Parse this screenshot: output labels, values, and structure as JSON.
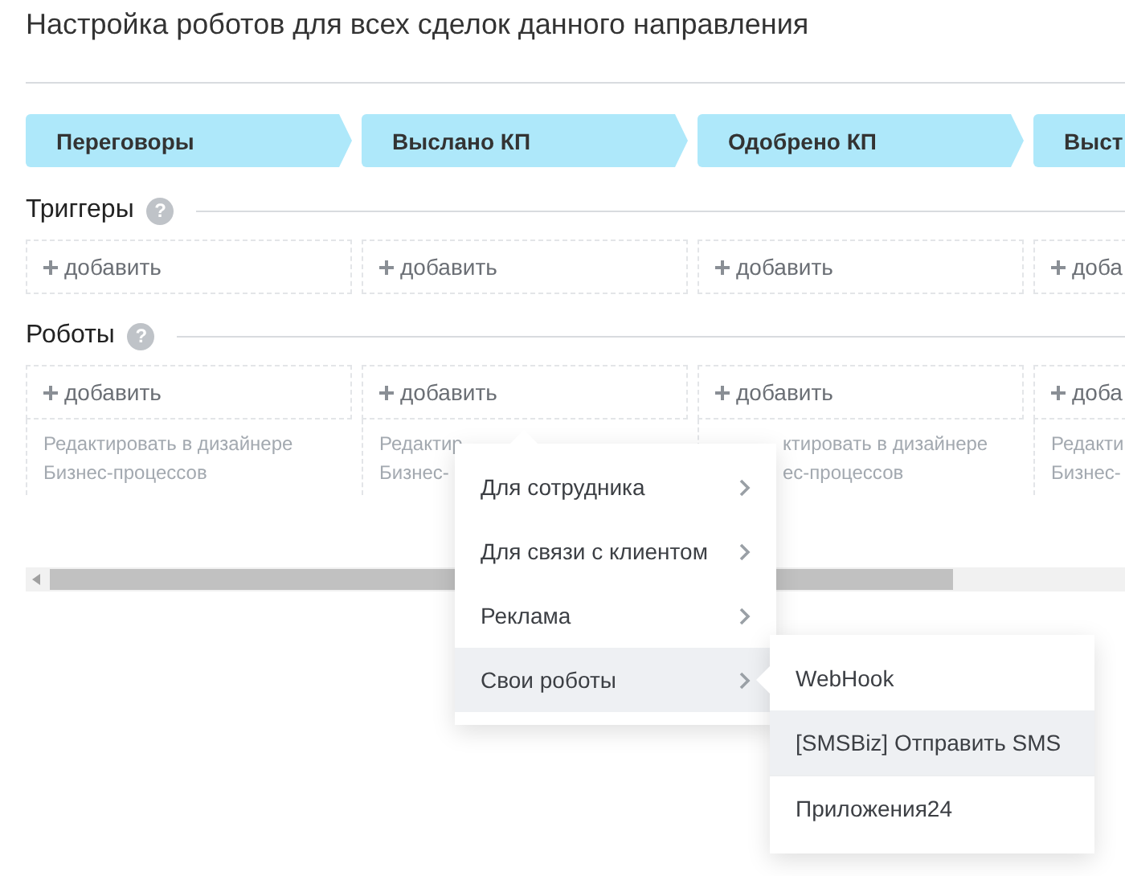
{
  "title": "Настройка роботов для всех сделок данного направления",
  "stages": [
    {
      "label": "Переговоры"
    },
    {
      "label": "Выслано КП"
    },
    {
      "label": "Одобрено КП"
    },
    {
      "label": "Выст"
    }
  ],
  "triggers": {
    "heading": "Триггеры",
    "help": "?",
    "cells": [
      {
        "add": "добавить"
      },
      {
        "add": "добавить"
      },
      {
        "add": "добавить"
      },
      {
        "add": "доба"
      }
    ]
  },
  "robots": {
    "heading": "Роботы",
    "help": "?",
    "cells": [
      {
        "add": "добавить",
        "kind": "plain",
        "edit_lines": [
          "Редактировать в дизайнере",
          "Бизнес-процессов"
        ]
      },
      {
        "add": "добавить",
        "kind": "plain",
        "edit_lines": [
          "Редактир",
          "Бизнес-"
        ]
      },
      {
        "add": "добавить",
        "kind": "cut_left",
        "edit_lines": [
          "ктировать в дизайнере",
          "ес-процессов"
        ]
      },
      {
        "add": "доба",
        "kind": "plain",
        "edit_lines": [
          "Редакти",
          "Бизнес-"
        ]
      }
    ]
  },
  "menu": {
    "items": [
      {
        "label": "Для сотрудника",
        "selected": false
      },
      {
        "label": "Для связи с клиентом",
        "selected": false
      },
      {
        "label": "Реклама",
        "selected": false
      },
      {
        "label": "Свои роботы",
        "selected": true
      }
    ]
  },
  "submenu": {
    "items": [
      {
        "label": "WebHook",
        "selected": false
      },
      {
        "label": "[SMSBiz] Отправить SMS",
        "selected": true
      },
      {
        "label": "Приложения24",
        "selected": false
      }
    ]
  }
}
